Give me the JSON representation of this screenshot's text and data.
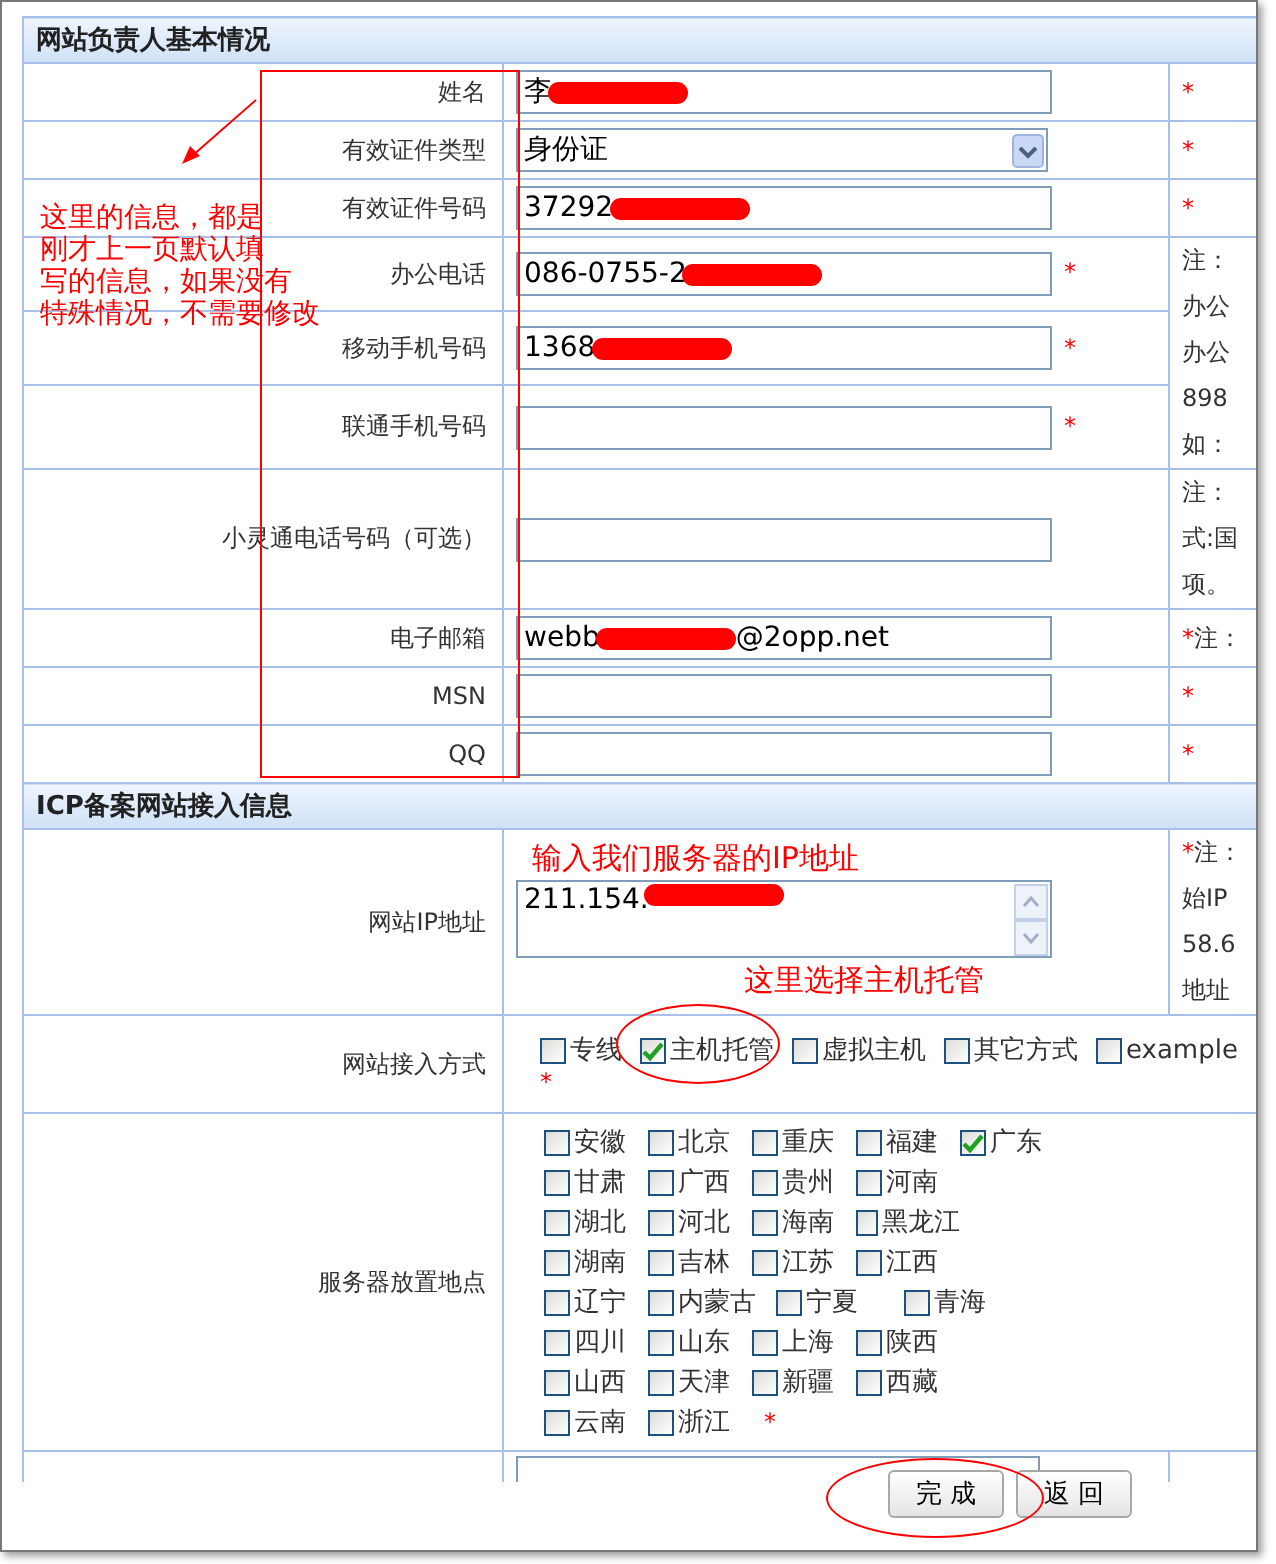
{
  "sections": [
    {
      "title": "网站负责人基本情况",
      "rows": [
        {
          "kind": "text",
          "label": "姓名",
          "value": "李",
          "redacted": true,
          "note_mark": "*"
        },
        {
          "kind": "select",
          "label": "有效证件类型",
          "value": "身份证",
          "note_mark": "*"
        },
        {
          "kind": "text",
          "label": "有效证件号码",
          "value": "37292",
          "redacted": true,
          "note_mark": "*"
        },
        {
          "kind": "text",
          "label": "办公电话",
          "value": "086-0755-2",
          "redacted": true,
          "inline_mark": "*",
          "note_lines": [
            "注：",
            "办公",
            "办公",
            "898",
            "如："
          ]
        },
        {
          "kind": "text",
          "label": "移动手机号码",
          "value": "1368",
          "redacted": true,
          "inline_mark": "*",
          "note_merged": true
        },
        {
          "kind": "text",
          "label": "联通手机号码",
          "inline_mark": "*",
          "note_merged": true
        },
        {
          "kind": "text",
          "label": "小灵通电话号码（可选）",
          "note_lines": [
            "注：",
            "式:国",
            "项。"
          ]
        },
        {
          "kind": "text",
          "label": "电子邮箱",
          "value": "webb",
          "redacted": true,
          "value_after": "@2opp.net",
          "note_mark": "*",
          "note_lines": [
            "注："
          ]
        },
        {
          "kind": "text",
          "label": "MSN",
          "note_mark": "*"
        },
        {
          "kind": "text",
          "label": "QQ",
          "note_mark": "*"
        }
      ]
    },
    {
      "title": "ICP备案网站接入信息",
      "rows": [
        {
          "kind": "textarea",
          "label": "网站IP地址",
          "value": "211.154.",
          "redacted": true,
          "note_mark": "*",
          "note_lines": [
            "注：",
            "始IP",
            "58.6",
            "地址"
          ]
        },
        {
          "kind": "checkboxes",
          "label": "网站接入方式",
          "below_mark": "*",
          "options": [
            {
              "label": "专线",
              "checked": false
            },
            {
              "label": "主机托管",
              "checked": true
            },
            {
              "label": "虚拟主机",
              "checked": false
            },
            {
              "label": "其它方式",
              "checked": false
            },
            {
              "label": "example",
              "checked": false
            }
          ]
        },
        {
          "kind": "checkbox_grid",
          "label": "服务器放置地点",
          "trailing_mark": "*",
          "option_rows": [
            [
              {
                "label": "安徽",
                "checked": false
              },
              {
                "label": "北京",
                "checked": false
              },
              {
                "label": "重庆",
                "checked": false
              },
              {
                "label": "福建",
                "checked": false
              },
              {
                "label": "广东",
                "checked": true
              }
            ],
            [
              {
                "label": "甘肃",
                "checked": false
              },
              {
                "label": "广西",
                "checked": false
              },
              {
                "label": "贵州",
                "checked": false
              },
              {
                "label": "河南",
                "checked": false
              }
            ],
            [
              {
                "label": "湖北",
                "checked": false
              },
              {
                "label": "河北",
                "checked": false
              },
              {
                "label": "海南",
                "checked": false
              },
              {
                "label": "黑龙江",
                "checked": false
              }
            ],
            [
              {
                "label": "湖南",
                "checked": false
              },
              {
                "label": "吉林",
                "checked": false
              },
              {
                "label": "江苏",
                "checked": false
              },
              {
                "label": "江西",
                "checked": false
              }
            ],
            [
              {
                "label": "辽宁",
                "checked": false
              },
              {
                "label": "内蒙古",
                "checked": false
              },
              {
                "label": "宁夏",
                "checked": false
              },
              {
                "label": "青海",
                "checked": false
              }
            ],
            [
              {
                "label": "四川",
                "checked": false
              },
              {
                "label": "山东",
                "checked": false
              },
              {
                "label": "上海",
                "checked": false
              },
              {
                "label": "陕西",
                "checked": false
              }
            ],
            [
              {
                "label": "山西",
                "checked": false
              },
              {
                "label": "天津",
                "checked": false
              },
              {
                "label": "新疆",
                "checked": false
              },
              {
                "label": "西藏",
                "checked": false
              }
            ],
            [
              {
                "label": "云南",
                "checked": false
              },
              {
                "label": "浙江",
                "checked": false
              }
            ]
          ]
        }
      ]
    }
  ],
  "buttons": [
    "完 成",
    "返 回"
  ],
  "annotations": [
    {
      "lines": [
        "这里的信息，都是",
        "刚才上一页默认填",
        "写的信息，如果没有",
        "特殊情况，不需要修改"
      ]
    },
    {
      "lines": [
        "输入我们服务器的IP地址"
      ]
    },
    {
      "lines": [
        "这里选择主机托管"
      ]
    }
  ]
}
